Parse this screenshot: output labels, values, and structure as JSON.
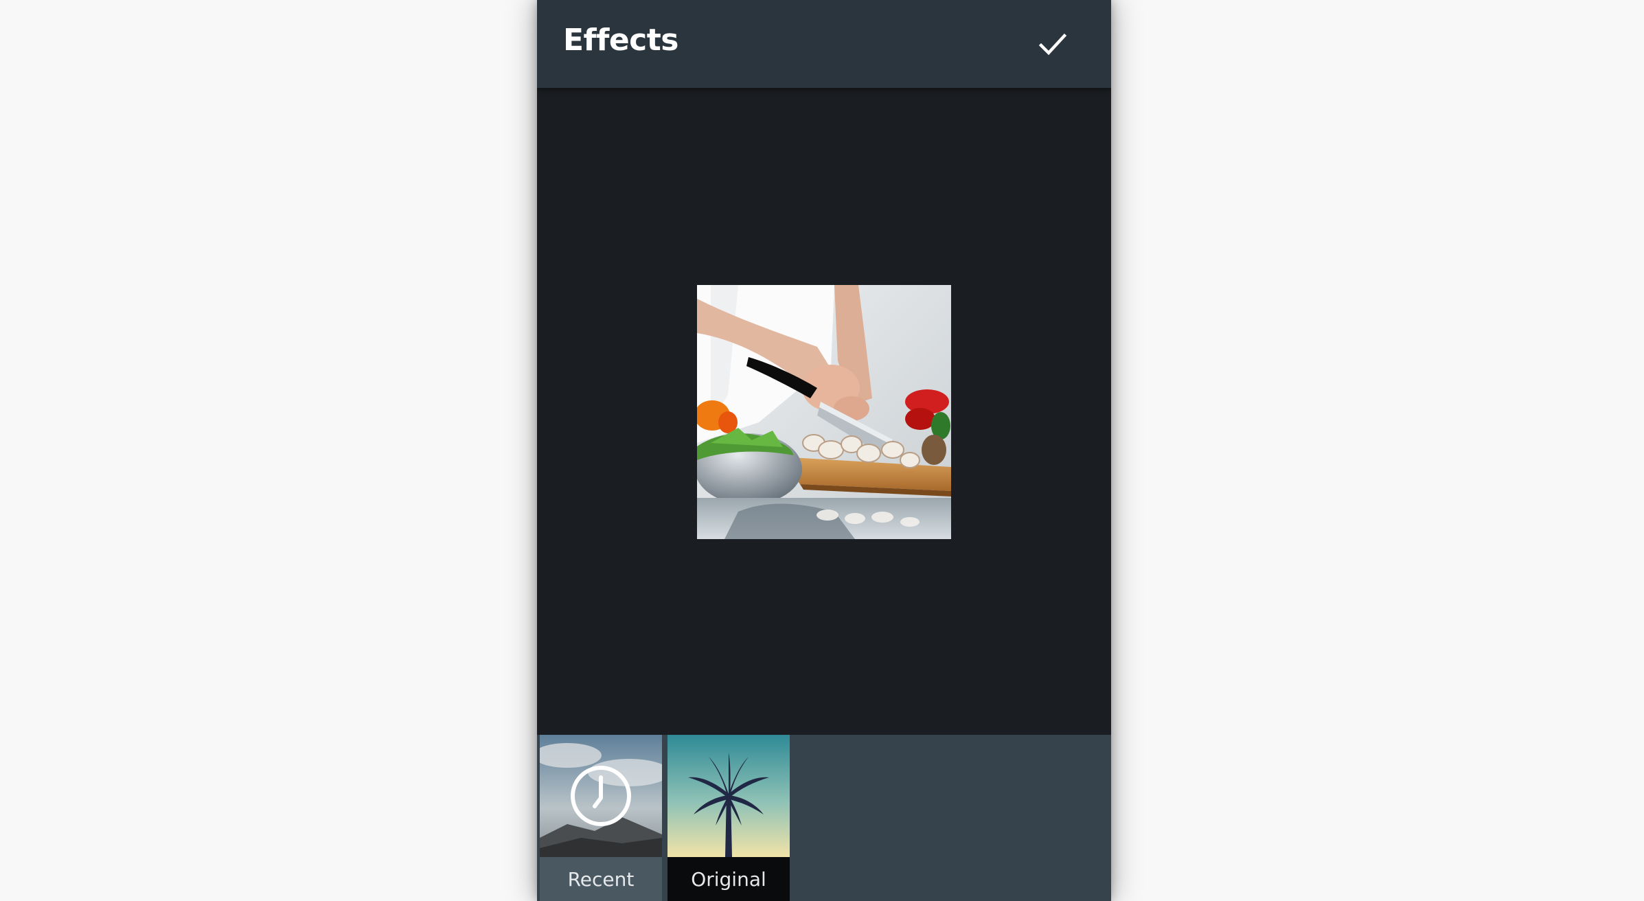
{
  "appbar": {
    "title": "Effects",
    "confirm_icon": "checkmark-icon"
  },
  "preview": {
    "image": "photo of hands slicing mushrooms on a cutting board with vegetables"
  },
  "effects_tray": {
    "items": [
      {
        "label": "Recent",
        "icon": "clock-icon",
        "thumbnail": "mountain-sky"
      },
      {
        "label": "Original",
        "icon": "",
        "thumbnail": "palm-tree-sky"
      }
    ]
  },
  "colors": {
    "appbar": "#2b353d",
    "canvas": "#1a1d21",
    "tray": "#36434c",
    "selected_label_bg": "#0a0b0c"
  }
}
